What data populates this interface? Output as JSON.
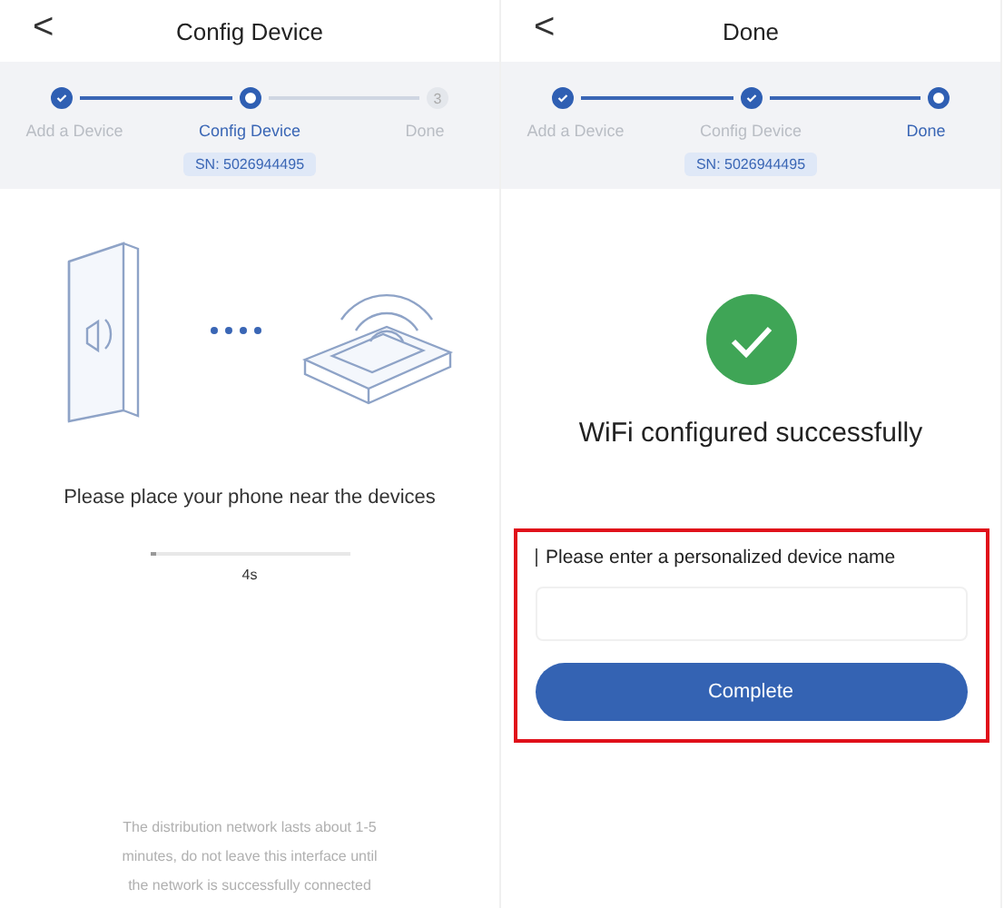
{
  "screens": [
    {
      "kind": "pairing",
      "title": "Config Device",
      "back": "<",
      "steps": [
        {
          "label": "Add a Device",
          "completed": true,
          "selected": false
        },
        {
          "label": "Config Device",
          "completed": false,
          "selected": true
        },
        {
          "label": "Done",
          "completed": false,
          "selected": false,
          "mark": "3"
        }
      ],
      "serial": "SN: 5026944495",
      "instruction": "Please place your phone near the devices",
      "progress": {
        "level": 0.03,
        "reading": "4s"
      },
      "tip": "The distribution network lasts about 1-5 minutes, do not leave this interface until the network is successfully connected"
    },
    {
      "kind": "success",
      "title": "Done",
      "back": "<",
      "steps": [
        {
          "label": "Add a Device",
          "completed": true,
          "selected": false
        },
        {
          "label": "Config Device",
          "completed": true,
          "selected": false
        },
        {
          "label": "Done",
          "completed": false,
          "selected": true
        }
      ],
      "serial": "SN: 5026944495",
      "message": "WiFi configured successfully",
      "name_form": {
        "highlighted": true,
        "label": "Please enter a personalized device name",
        "button": "Complete"
      }
    }
  ]
}
